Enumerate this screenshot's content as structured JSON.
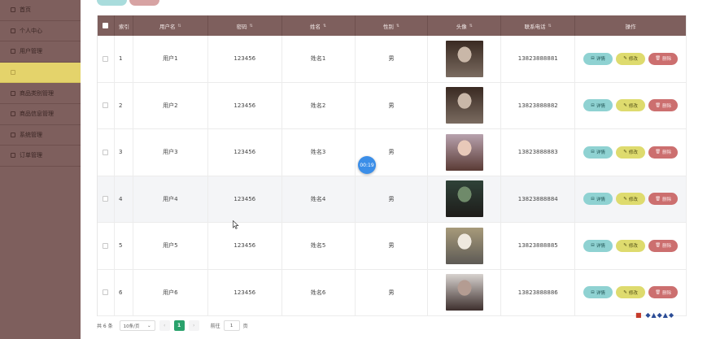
{
  "sidebar": {
    "items": [
      {
        "label": "首页",
        "active": false
      },
      {
        "label": "个人中心",
        "active": false
      },
      {
        "label": "用户管理",
        "active": false
      },
      {
        "label": "",
        "active": true
      },
      {
        "label": "商品类别管理",
        "active": false
      },
      {
        "label": "商品信息管理",
        "active": false
      },
      {
        "label": "系统管理",
        "active": false
      },
      {
        "label": "订单管理",
        "active": false
      }
    ]
  },
  "table": {
    "headers": {
      "index": "索引",
      "username": "用户名",
      "password": "密码",
      "name": "姓名",
      "gender": "性别",
      "avatar": "头像",
      "phone": "联系电话",
      "ops": "操作"
    },
    "rows": [
      {
        "index": "1",
        "username": "用户1",
        "password": "123456",
        "name": "姓名1",
        "gender": "男",
        "phone": "13823888881",
        "photo_colors": [
          "#3a2a22",
          "#c9b7a8",
          "#7a6b60"
        ]
      },
      {
        "index": "2",
        "username": "用户2",
        "password": "123456",
        "name": "姓名2",
        "gender": "男",
        "phone": "13823888882",
        "photo_colors": [
          "#3a2a22",
          "#c9b7a8",
          "#7a6b60"
        ]
      },
      {
        "index": "3",
        "username": "用户3",
        "password": "123456",
        "name": "姓名3",
        "gender": "男",
        "phone": "13823888883",
        "photo_colors": [
          "#b8a2ae",
          "#e8c9b9",
          "#5a3b35"
        ]
      },
      {
        "index": "4",
        "username": "用户4",
        "password": "123456",
        "name": "姓名4",
        "gender": "男",
        "phone": "13823888884",
        "photo_colors": [
          "#2f4238",
          "#6f8a6a",
          "#1e1c1a"
        ]
      },
      {
        "index": "5",
        "username": "用户5",
        "password": "123456",
        "name": "姓名5",
        "gender": "男",
        "phone": "13823888885",
        "photo_colors": [
          "#a79a7a",
          "#efe9df",
          "#5d5a55"
        ]
      },
      {
        "index": "6",
        "username": "用户6",
        "password": "123456",
        "name": "姓名6",
        "gender": "男",
        "phone": "13823888886",
        "photo_colors": [
          "#d7d2cf",
          "#b49c92",
          "#3d2f2d"
        ]
      }
    ],
    "buttons": {
      "detail": "详情",
      "edit": "修改",
      "delete": "删除"
    },
    "hover_row": 3
  },
  "pagination": {
    "total": "共 6 条",
    "page_size": "10条/页",
    "prev": "‹",
    "current": "1",
    "next": "›",
    "goto_label": "前往",
    "goto_value": "1",
    "page_suffix": "页"
  },
  "overlay": {
    "timer": "00:19"
  },
  "colors": {
    "sidebar": "#7e5f5d",
    "active": "#e4d36b",
    "detail": "#8fd2d2",
    "edit": "#dedb6e",
    "delete": "#cc6f6f",
    "page_current": "#2aa26c"
  }
}
